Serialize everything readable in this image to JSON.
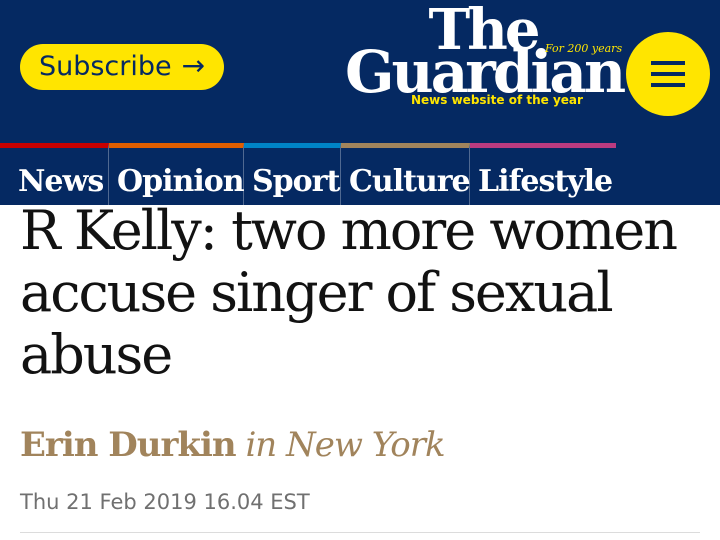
{
  "header": {
    "subscribe_label": "Subscribe",
    "subscribe_arrow": "→",
    "logo_line1": "The",
    "logo_line2": "Guardian",
    "logo_badge": "For 200 years",
    "tagline": "News website of the year",
    "menu_icon": "hamburger-menu-icon"
  },
  "nav": {
    "items": [
      {
        "label": "News",
        "color": "#c70000"
      },
      {
        "label": "Opinion",
        "color": "#e05e00"
      },
      {
        "label": "Sport",
        "color": "#0084c6"
      },
      {
        "label": "Culture",
        "color": "#a1845c"
      },
      {
        "label": "Lifestyle",
        "color": "#bb3b80"
      }
    ]
  },
  "article": {
    "headline": "R Kelly: two more women accuse singer of sexual abuse",
    "author": "Erin Durkin",
    "location": "in New York",
    "date": "Thu 21 Feb 2019 16.04 EST"
  },
  "colors": {
    "brand_blue": "#052962",
    "brand_yellow": "#ffe500",
    "byline_gold": "#a1845c"
  }
}
